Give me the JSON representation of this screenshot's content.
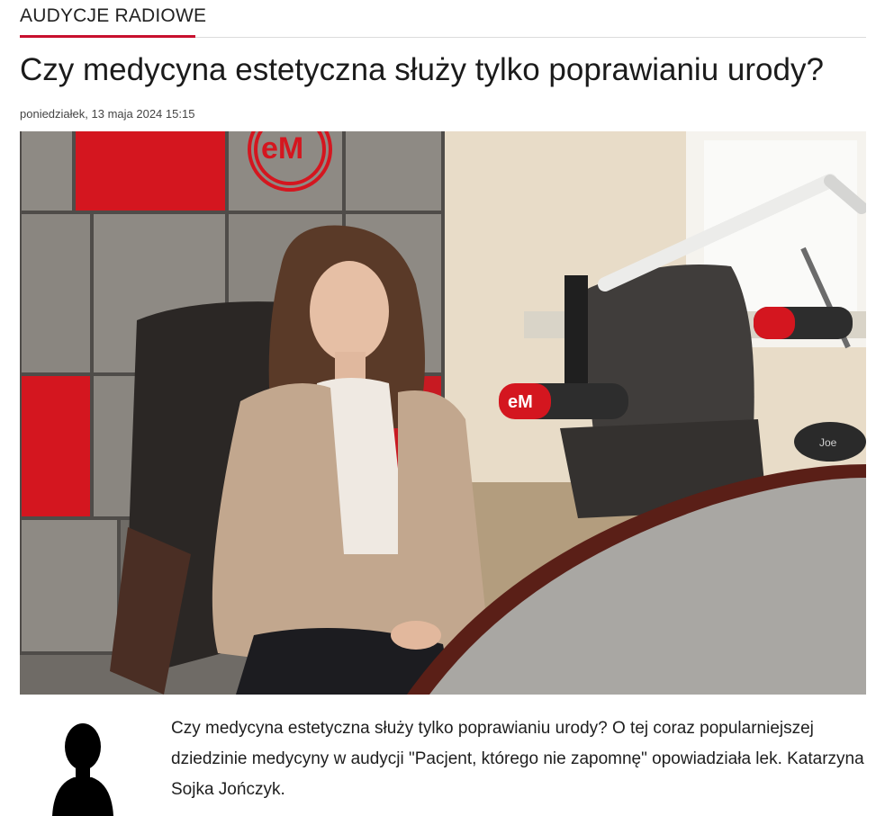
{
  "section": {
    "label": "AUDYCJE RADIOWE"
  },
  "article": {
    "title": "Czy medycyna estetyczna służy tylko poprawianiu urody?",
    "date": "poniedziałek, 13 maja 2024 15:15",
    "lead": "Czy medycyna estetyczna służy tylko poprawianiu urody? O tej coraz popularniejszej dziedzinie medycyny w audycji \"Pacjent, którego nie zapomnę\" opowiadziała lek. Katarzyna Sojka Jończyk."
  },
  "photo": {
    "logo_text": "eM",
    "headphones_text": "Joe"
  },
  "colors": {
    "accent": "#c8102e",
    "panel_red": "#d4161f",
    "panel_gray": "#8a8680"
  },
  "icons": {
    "author_avatar": "person-silhouette-icon"
  }
}
